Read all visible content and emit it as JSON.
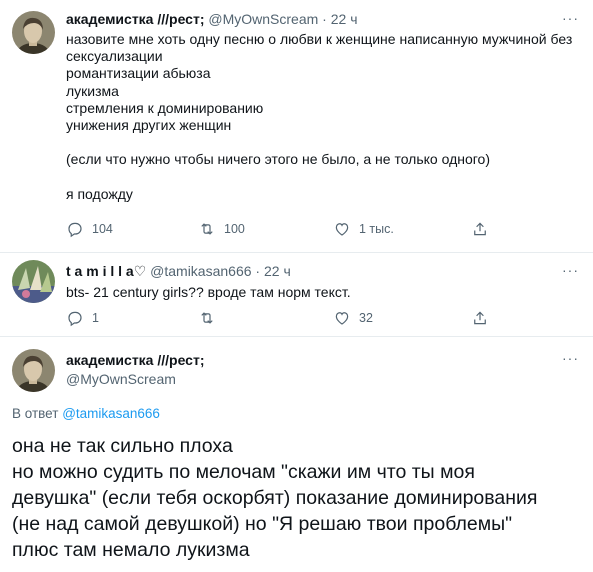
{
  "tweet1": {
    "name": "академистка ///рест;",
    "handle": "@MyOwnScream",
    "separator": "·",
    "time": "22 ч",
    "more": "···",
    "lines": [
      "назовите мне хоть одну песню о любви к женщине написанную мужчиной без",
      "сексуализации",
      "романтизации абьюза",
      "лукизма",
      "стремления к доминированию",
      "унижения других женщин",
      "",
      "(если что нужно чтобы ничего этого не было, а не только одного)",
      "",
      "я подожду"
    ],
    "replies": "104",
    "retweets": "100",
    "likes": "1 тыс."
  },
  "tweet2": {
    "name": "t a m i l l a♡",
    "handle": "@tamikasan666",
    "separator": "·",
    "time": "22 ч",
    "more": "···",
    "text": "bts- 21 century girls?? вроде там норм текст.",
    "replies": "1",
    "retweets": "",
    "likes": "32"
  },
  "tweet3": {
    "name": "академистка ///рест;",
    "handle": "@MyOwnScream",
    "more": "···",
    "reply_prefix": "В ответ",
    "reply_handle": "@tamikasan666",
    "lines": [
      "она не так сильно плоха",
      "но можно судить по мелочам \"скажи им что ты моя",
      "девушка\" (если тебя оскорбят) показание доминирования",
      "(не над самой девушкой) но \"Я решаю твои проблемы\"",
      "плюс там немало лукизма"
    ]
  },
  "colors": {
    "text": "#0f1419",
    "muted": "#536471",
    "link": "#1d9bf0",
    "divider": "#e7ecef"
  },
  "icons": [
    "reply-icon",
    "retweet-icon",
    "like-icon",
    "share-icon",
    "more-icon"
  ]
}
